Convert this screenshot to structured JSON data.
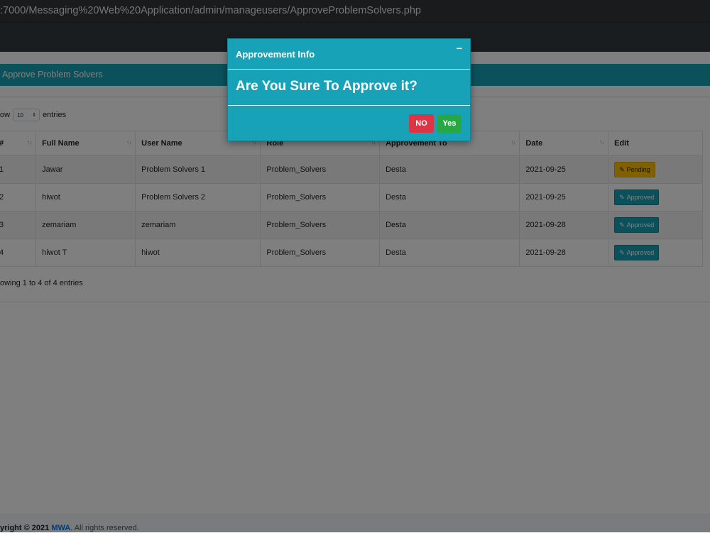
{
  "browser": {
    "url": ":7000/Messaging%20Web%20Application/admin/manageusers/ApproveProblemSolvers.php"
  },
  "card": {
    "title": "Approve Problem Solvers"
  },
  "length_control": {
    "prefix": "ow",
    "value": "10",
    "suffix": "entries"
  },
  "table": {
    "columns": [
      "#",
      "Full Name",
      "User Name",
      "Role",
      "Approvement To",
      "Date",
      "Edit"
    ],
    "rows": [
      {
        "id": "1",
        "full_name": "Jawar",
        "user_name": "Problem Solvers 1",
        "role": "Problem_Solvers",
        "approvement_to": "Desta",
        "date": "2021-09-25",
        "status": "Pending"
      },
      {
        "id": "2",
        "full_name": "hiwot",
        "user_name": "Problem Solvers 2",
        "role": "Problem_Solvers",
        "approvement_to": "Desta",
        "date": "2021-09-25",
        "status": "Approved"
      },
      {
        "id": "3",
        "full_name": "zemariam",
        "user_name": "zemariam",
        "role": "Problem_Solvers",
        "approvement_to": "Desta",
        "date": "2021-09-28",
        "status": "Approved"
      },
      {
        "id": "4",
        "full_name": "hiwot T",
        "user_name": "hiwot",
        "role": "Problem_Solvers",
        "approvement_to": "Desta",
        "date": "2021-09-28",
        "status": "Approved"
      }
    ]
  },
  "info": "owing 1 to 4 of 4 entries",
  "footer": {
    "copyright": "yright © 2021 ",
    "brand": "MWA",
    "rights": ". All rights reserved."
  },
  "modal": {
    "title": "Approvement Info",
    "close_symbol": "−",
    "message": "Are You Sure To Approve it?",
    "no_label": "NO",
    "yes_label": "Yes"
  },
  "colors": {
    "accent": "#17a2b8",
    "pending": "#ffc107",
    "danger": "#dc3545",
    "success": "#28a745"
  }
}
